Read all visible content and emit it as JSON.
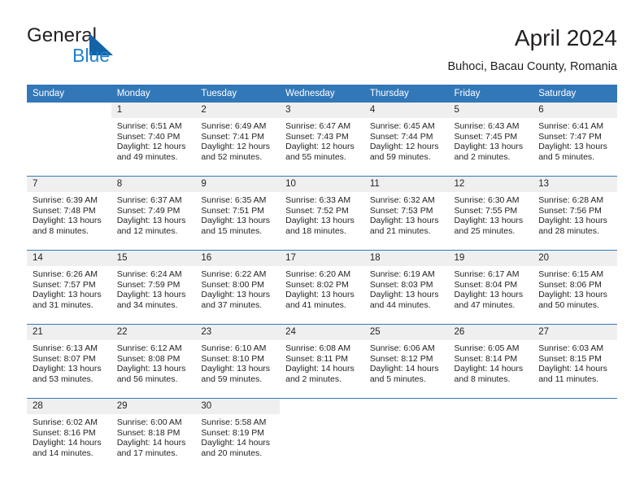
{
  "brand": {
    "name_part1": "General",
    "name_part2": "Blue",
    "flag_icon": "blue-triangle-flag-icon",
    "accent_color": "#1f7fd1"
  },
  "header": {
    "month_title": "April 2024",
    "location": "Buhoci, Bacau County, Romania"
  },
  "calendar": {
    "header_color": "#3278b9",
    "daynum_band_color": "#efefef",
    "weekday_headers": [
      "Sunday",
      "Monday",
      "Tuesday",
      "Wednesday",
      "Thursday",
      "Friday",
      "Saturday"
    ],
    "weeks": [
      [
        {
          "day": "",
          "lines": []
        },
        {
          "day": "1",
          "lines": [
            "Sunrise: 6:51 AM",
            "Sunset: 7:40 PM",
            "Daylight: 12 hours",
            "and 49 minutes."
          ]
        },
        {
          "day": "2",
          "lines": [
            "Sunrise: 6:49 AM",
            "Sunset: 7:41 PM",
            "Daylight: 12 hours",
            "and 52 minutes."
          ]
        },
        {
          "day": "3",
          "lines": [
            "Sunrise: 6:47 AM",
            "Sunset: 7:43 PM",
            "Daylight: 12 hours",
            "and 55 minutes."
          ]
        },
        {
          "day": "4",
          "lines": [
            "Sunrise: 6:45 AM",
            "Sunset: 7:44 PM",
            "Daylight: 12 hours",
            "and 59 minutes."
          ]
        },
        {
          "day": "5",
          "lines": [
            "Sunrise: 6:43 AM",
            "Sunset: 7:45 PM",
            "Daylight: 13 hours",
            "and 2 minutes."
          ]
        },
        {
          "day": "6",
          "lines": [
            "Sunrise: 6:41 AM",
            "Sunset: 7:47 PM",
            "Daylight: 13 hours",
            "and 5 minutes."
          ]
        }
      ],
      [
        {
          "day": "7",
          "lines": [
            "Sunrise: 6:39 AM",
            "Sunset: 7:48 PM",
            "Daylight: 13 hours",
            "and 8 minutes."
          ]
        },
        {
          "day": "8",
          "lines": [
            "Sunrise: 6:37 AM",
            "Sunset: 7:49 PM",
            "Daylight: 13 hours",
            "and 12 minutes."
          ]
        },
        {
          "day": "9",
          "lines": [
            "Sunrise: 6:35 AM",
            "Sunset: 7:51 PM",
            "Daylight: 13 hours",
            "and 15 minutes."
          ]
        },
        {
          "day": "10",
          "lines": [
            "Sunrise: 6:33 AM",
            "Sunset: 7:52 PM",
            "Daylight: 13 hours",
            "and 18 minutes."
          ]
        },
        {
          "day": "11",
          "lines": [
            "Sunrise: 6:32 AM",
            "Sunset: 7:53 PM",
            "Daylight: 13 hours",
            "and 21 minutes."
          ]
        },
        {
          "day": "12",
          "lines": [
            "Sunrise: 6:30 AM",
            "Sunset: 7:55 PM",
            "Daylight: 13 hours",
            "and 25 minutes."
          ]
        },
        {
          "day": "13",
          "lines": [
            "Sunrise: 6:28 AM",
            "Sunset: 7:56 PM",
            "Daylight: 13 hours",
            "and 28 minutes."
          ]
        }
      ],
      [
        {
          "day": "14",
          "lines": [
            "Sunrise: 6:26 AM",
            "Sunset: 7:57 PM",
            "Daylight: 13 hours",
            "and 31 minutes."
          ]
        },
        {
          "day": "15",
          "lines": [
            "Sunrise: 6:24 AM",
            "Sunset: 7:59 PM",
            "Daylight: 13 hours",
            "and 34 minutes."
          ]
        },
        {
          "day": "16",
          "lines": [
            "Sunrise: 6:22 AM",
            "Sunset: 8:00 PM",
            "Daylight: 13 hours",
            "and 37 minutes."
          ]
        },
        {
          "day": "17",
          "lines": [
            "Sunrise: 6:20 AM",
            "Sunset: 8:02 PM",
            "Daylight: 13 hours",
            "and 41 minutes."
          ]
        },
        {
          "day": "18",
          "lines": [
            "Sunrise: 6:19 AM",
            "Sunset: 8:03 PM",
            "Daylight: 13 hours",
            "and 44 minutes."
          ]
        },
        {
          "day": "19",
          "lines": [
            "Sunrise: 6:17 AM",
            "Sunset: 8:04 PM",
            "Daylight: 13 hours",
            "and 47 minutes."
          ]
        },
        {
          "day": "20",
          "lines": [
            "Sunrise: 6:15 AM",
            "Sunset: 8:06 PM",
            "Daylight: 13 hours",
            "and 50 minutes."
          ]
        }
      ],
      [
        {
          "day": "21",
          "lines": [
            "Sunrise: 6:13 AM",
            "Sunset: 8:07 PM",
            "Daylight: 13 hours",
            "and 53 minutes."
          ]
        },
        {
          "day": "22",
          "lines": [
            "Sunrise: 6:12 AM",
            "Sunset: 8:08 PM",
            "Daylight: 13 hours",
            "and 56 minutes."
          ]
        },
        {
          "day": "23",
          "lines": [
            "Sunrise: 6:10 AM",
            "Sunset: 8:10 PM",
            "Daylight: 13 hours",
            "and 59 minutes."
          ]
        },
        {
          "day": "24",
          "lines": [
            "Sunrise: 6:08 AM",
            "Sunset: 8:11 PM",
            "Daylight: 14 hours",
            "and 2 minutes."
          ]
        },
        {
          "day": "25",
          "lines": [
            "Sunrise: 6:06 AM",
            "Sunset: 8:12 PM",
            "Daylight: 14 hours",
            "and 5 minutes."
          ]
        },
        {
          "day": "26",
          "lines": [
            "Sunrise: 6:05 AM",
            "Sunset: 8:14 PM",
            "Daylight: 14 hours",
            "and 8 minutes."
          ]
        },
        {
          "day": "27",
          "lines": [
            "Sunrise: 6:03 AM",
            "Sunset: 8:15 PM",
            "Daylight: 14 hours",
            "and 11 minutes."
          ]
        }
      ],
      [
        {
          "day": "28",
          "lines": [
            "Sunrise: 6:02 AM",
            "Sunset: 8:16 PM",
            "Daylight: 14 hours",
            "and 14 minutes."
          ]
        },
        {
          "day": "29",
          "lines": [
            "Sunrise: 6:00 AM",
            "Sunset: 8:18 PM",
            "Daylight: 14 hours",
            "and 17 minutes."
          ]
        },
        {
          "day": "30",
          "lines": [
            "Sunrise: 5:58 AM",
            "Sunset: 8:19 PM",
            "Daylight: 14 hours",
            "and 20 minutes."
          ]
        },
        {
          "day": "",
          "lines": []
        },
        {
          "day": "",
          "lines": []
        },
        {
          "day": "",
          "lines": []
        },
        {
          "day": "",
          "lines": []
        }
      ]
    ]
  }
}
